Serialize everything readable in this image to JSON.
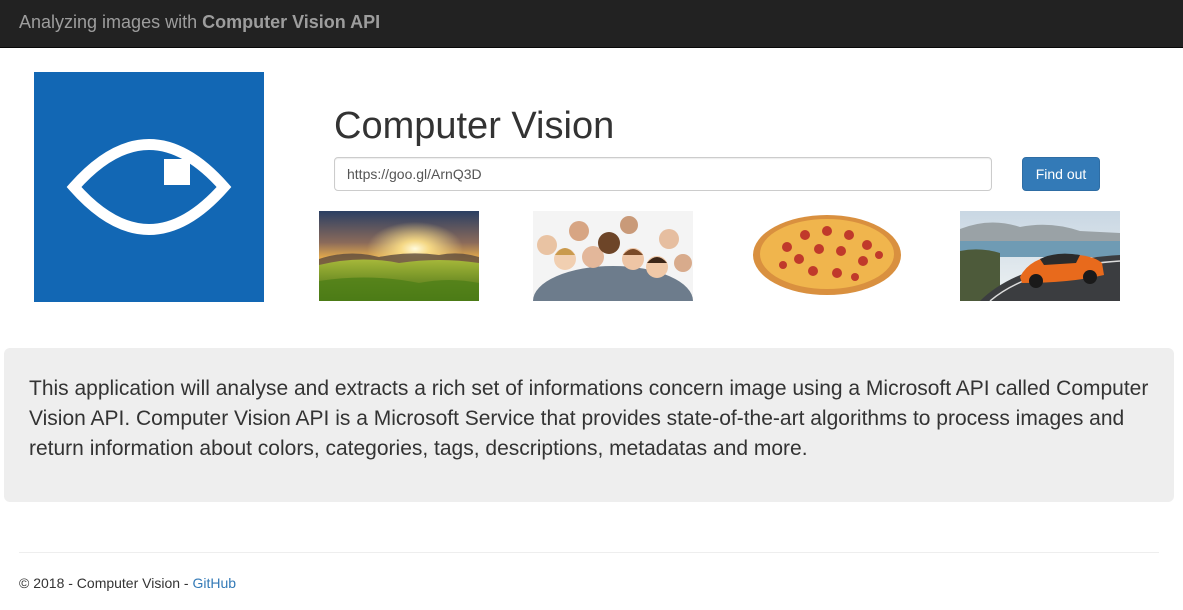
{
  "navbar": {
    "brand_prefix": "Analyzing images with ",
    "brand_bold": "Computer Vision API"
  },
  "logo": {
    "icon": "eye-icon",
    "background": "#1267b4"
  },
  "main": {
    "title": "Computer Vision",
    "url_input": {
      "value": "https://goo.gl/ArnQ3D"
    },
    "submit_label": "Find out"
  },
  "samples": [
    {
      "name": "sunset-landscape"
    },
    {
      "name": "group-of-people"
    },
    {
      "name": "pizza"
    },
    {
      "name": "orange-sports-car"
    }
  ],
  "description": "This application will analyse and extracts a rich set of informations concern image using a Microsoft API called Computer Vision API. Computer Vision API is a Microsoft Service that provides state-of-the-art algorithms to process images and return information about colors, categories, tags, descriptions, metadatas and more.",
  "footer": {
    "copyright": "© 2018 - Computer Vision - ",
    "link_label": "GitHub"
  },
  "colors": {
    "navbar": "#222222",
    "primary": "#337ab7",
    "jumbotron": "#eeeeee"
  }
}
